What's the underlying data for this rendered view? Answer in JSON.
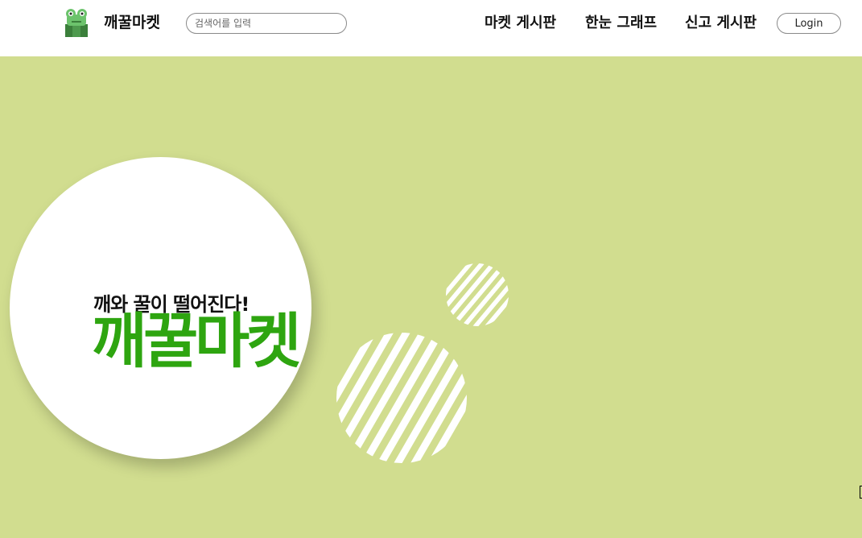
{
  "header": {
    "logo_icon": "frog-icon",
    "brand": "깨꿀마켓",
    "search": {
      "placeholder": "검색어를 입력",
      "value": ""
    },
    "nav": [
      {
        "label": "마켓 게시판"
      },
      {
        "label": "한눈 그래프"
      },
      {
        "label": "신고 게시판"
      }
    ],
    "login_label": "Login"
  },
  "hero": {
    "tagline": "깨와 꿀이 떨어진다!",
    "title": "깨꿀마켓"
  },
  "colors": {
    "background": "#d1dd8f",
    "header_bg": "#ffffff",
    "title_green": "#2ea510",
    "logo_green": "#5cb85c"
  }
}
